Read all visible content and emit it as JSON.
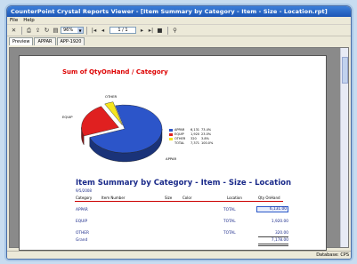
{
  "window": {
    "title": "CounterPoint Crystal Reports Viewer - [Item Summary by Category - Item - Size - Location.rpt]"
  },
  "menu": {
    "items": [
      "File",
      "Help"
    ]
  },
  "toolbar": {
    "zoom": "96%",
    "page_current": "1",
    "page_of": "/ 1"
  },
  "tabs": [
    "Preview",
    "APPAR",
    "APP-1920"
  ],
  "chart_data": {
    "type": "pie",
    "title": "Sum of QtyOnHand / Category",
    "categories": [
      "APPAR",
      "EQUIP",
      "OTHER"
    ],
    "values": [
      6131,
      1920,
      320
    ],
    "colors": [
      "#2c55c9",
      "#e02020",
      "#f5e51e"
    ],
    "slice_labels": [
      "APPAR",
      "EQUIP",
      "OTHER"
    ],
    "legend": [
      {
        "name": "APPAR",
        "value": "6,131",
        "pct": "73.4%"
      },
      {
        "name": "EQUIP",
        "value": "1,920",
        "pct": "23.0%"
      },
      {
        "name": "OTHER",
        "value": "320",
        "pct": "3.8%"
      },
      {
        "name": "TOTAL",
        "value": "7,371",
        "pct": "100.0%"
      }
    ]
  },
  "report": {
    "title": "Item Summary by Category - Item - Size - Location",
    "date": "9/5/2008",
    "headers": {
      "category": "Category",
      "item": "Item Number",
      "size": "Size",
      "color": "Color",
      "location": "Location",
      "qty": "Qty OnHand"
    },
    "rows": [
      {
        "category": "APPAR",
        "location": "TOTAL",
        "qty": "6,131.00"
      },
      {
        "category": "EQUIP",
        "location": "TOTAL",
        "qty": "1,920.00"
      },
      {
        "category": "OTHER",
        "location": "TOTAL",
        "qty": "320.00"
      }
    ],
    "grand_label": "Grand",
    "grand_total": "7,178.00"
  },
  "status": {
    "database": "Database: CPS"
  }
}
